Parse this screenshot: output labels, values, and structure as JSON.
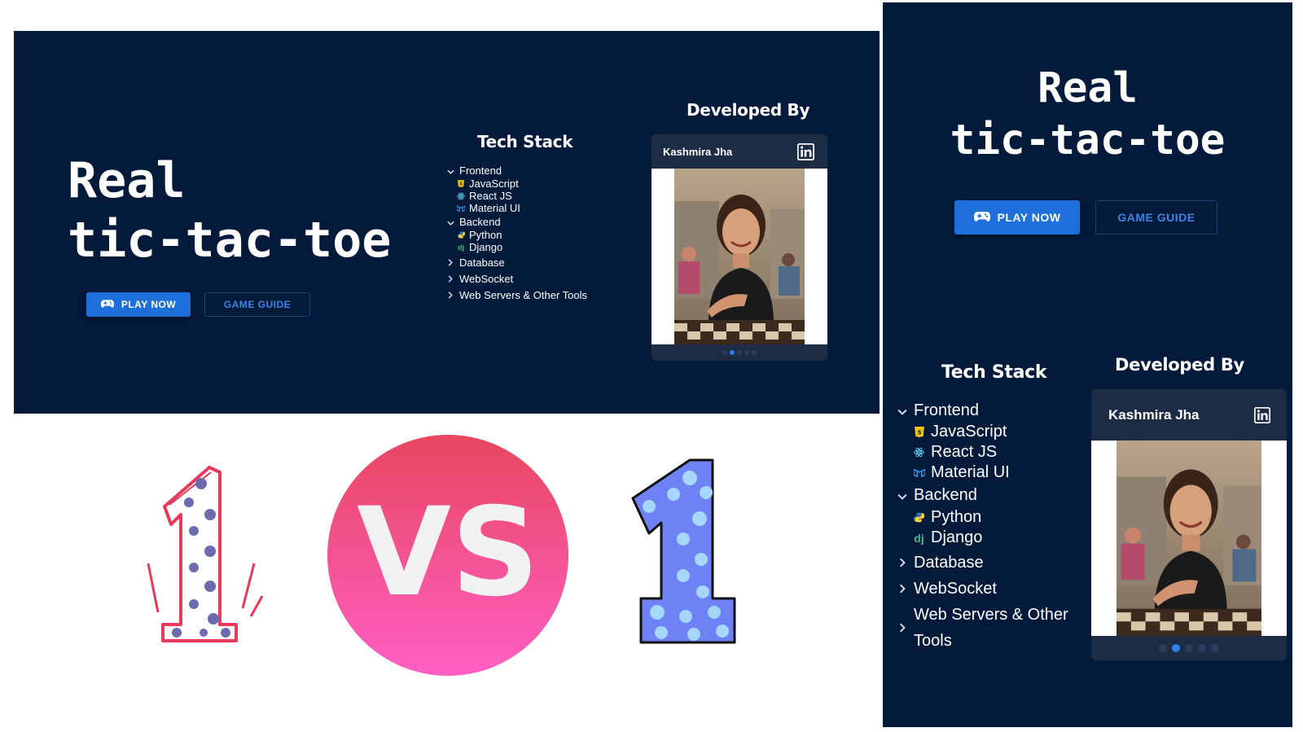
{
  "hero": {
    "title_line1": "Real",
    "title_line2": "tic-tac-toe"
  },
  "buttons": {
    "play": "PLAY NOW",
    "guide": "GAME GUIDE"
  },
  "tech_stack": {
    "title": "Tech Stack",
    "groups": [
      {
        "label": "Frontend",
        "expanded": true,
        "items": [
          {
            "label": "JavaScript",
            "icon": "javascript-icon"
          },
          {
            "label": "React JS",
            "icon": "react-icon"
          },
          {
            "label": "Material UI",
            "icon": "material-ui-icon"
          }
        ]
      },
      {
        "label": "Backend",
        "expanded": true,
        "items": [
          {
            "label": "Python",
            "icon": "python-icon"
          },
          {
            "label": "Django",
            "icon": "django-icon"
          }
        ]
      },
      {
        "label": "Database",
        "expanded": false
      },
      {
        "label": "WebSocket",
        "expanded": false
      },
      {
        "label": "Web Servers & Other Tools",
        "expanded": false
      }
    ],
    "mobile_last_line1": "Web Servers & Other",
    "mobile_last_line2": "Tools"
  },
  "developer": {
    "title": "Developed By",
    "name": "Kashmira Jha",
    "link_icon": "linkedin-icon",
    "carousel_total": 5,
    "carousel_active": 2
  },
  "versus": {
    "vs_text": "VS",
    "left_digit": "1",
    "right_digit": "1"
  },
  "colors": {
    "panel_bg": "#031a3b",
    "primary": "#1e6fd9",
    "guide_text": "#3d84e6",
    "card_bg": "#1c2c45",
    "vs_top": "#e8475f",
    "vs_bottom": "#ff5fc4",
    "number_blue": "#6f82f5",
    "number_red": "#e83a58"
  }
}
